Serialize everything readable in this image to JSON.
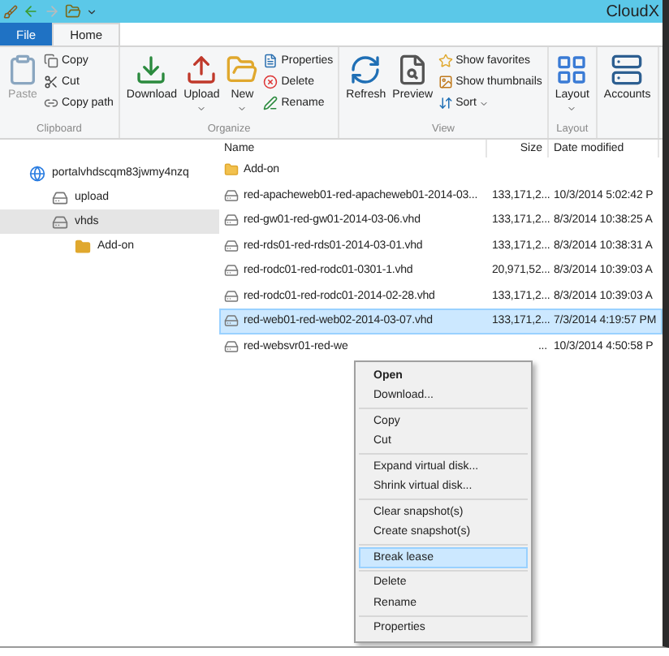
{
  "window": {
    "title": "CloudX"
  },
  "tabs": [
    {
      "label": "File",
      "kind": "file",
      "selected": false
    },
    {
      "label": "Home",
      "kind": "tab",
      "selected": true
    }
  ],
  "ribbon": {
    "groups": [
      {
        "label": "Clipboard",
        "large": [
          {
            "label": "Paste",
            "kind": "paste",
            "disabled": true,
            "dropdown": false
          }
        ],
        "small": [
          {
            "label": "Copy",
            "kind": "copy"
          },
          {
            "label": "Cut",
            "kind": "cut"
          },
          {
            "label": "Copy path",
            "kind": "copypath"
          }
        ]
      },
      {
        "label": "Organize",
        "large": [
          {
            "label": "Download",
            "kind": "download",
            "disabled": false,
            "dropdown": false
          },
          {
            "label": "Upload",
            "kind": "upload",
            "disabled": false,
            "dropdown": true
          },
          {
            "label": "New",
            "kind": "new",
            "disabled": false,
            "dropdown": true
          }
        ],
        "small": [
          {
            "label": "Properties",
            "kind": "properties"
          },
          {
            "label": "Delete",
            "kind": "delete"
          },
          {
            "label": "Rename",
            "kind": "rename"
          }
        ]
      },
      {
        "label": "View",
        "large": [
          {
            "label": "Refresh",
            "kind": "refresh",
            "disabled": false,
            "dropdown": false
          },
          {
            "label": "Preview",
            "kind": "preview",
            "disabled": false,
            "dropdown": false
          }
        ],
        "small": [
          {
            "label": "Show favorites",
            "kind": "favorites"
          },
          {
            "label": "Show thumbnails",
            "kind": "thumbnails"
          },
          {
            "label": "Sort",
            "kind": "sort",
            "dropdown": true
          }
        ]
      },
      {
        "label": "Layout",
        "large": [
          {
            "label": "Layout",
            "kind": "layout",
            "disabled": false,
            "dropdown": true
          }
        ]
      },
      {
        "large": [
          {
            "label": "Accounts",
            "kind": "accounts",
            "disabled": false,
            "dropdown": false
          }
        ]
      }
    ]
  },
  "tree": [
    {
      "label": "portalvhdscqm83jwmy4nzq",
      "kind": "account",
      "selected": false,
      "children": [
        {
          "label": "upload",
          "kind": "container",
          "selected": false
        },
        {
          "label": "vhds",
          "kind": "container",
          "selected": true,
          "children": [
            {
              "label": "Add-on",
              "kind": "folder",
              "selected": false
            }
          ]
        }
      ]
    }
  ],
  "file_list": {
    "columns": [
      "Name",
      "Size",
      "Date modified"
    ],
    "rows": [
      {
        "kind": "folder",
        "name": "Add-on",
        "selected": false
      },
      {
        "kind": "disk",
        "name": "red-apacheweb01-red-apacheweb01-2014-03...",
        "size": "133,171,2...",
        "date": "10/3/2014 5:02:42 P",
        "selected": false
      },
      {
        "kind": "disk",
        "name": "red-gw01-red-gw01-2014-03-06.vhd",
        "size": "133,171,2...",
        "date": "8/3/2014 10:38:25 A",
        "selected": false
      },
      {
        "kind": "disk",
        "name": "red-rds01-red-rds01-2014-03-01.vhd",
        "size": "133,171,2...",
        "date": "8/3/2014 10:38:31 A",
        "selected": false
      },
      {
        "kind": "disk",
        "name": "red-rodc01-red-rodc01-0301-1.vhd",
        "size": "20,971,52...",
        "date": "8/3/2014 10:39:03 A",
        "selected": false
      },
      {
        "kind": "disk",
        "name": "red-rodc01-red-rodc01-2014-02-28.vhd",
        "size": "133,171,2...",
        "date": "8/3/2014 10:39:03 A",
        "selected": false
      },
      {
        "kind": "disk",
        "name": "red-web01-red-web02-2014-03-07.vhd",
        "size": "133,171,2...",
        "date": "7/3/2014 4:19:57 PM",
        "selected": true
      },
      {
        "kind": "disk",
        "name": "red-websvr01-red-we",
        "size": "...",
        "date": "10/3/2014 4:50:58 P",
        "selected": false
      }
    ]
  },
  "context_menu": {
    "groups": [
      [
        {
          "label": "Open",
          "bold": true,
          "selected": false
        },
        {
          "label": "Download...",
          "bold": false,
          "selected": false
        }
      ],
      [
        {
          "label": "Copy",
          "bold": false,
          "selected": false
        },
        {
          "label": "Cut",
          "bold": false,
          "selected": false
        }
      ],
      [
        {
          "label": "Expand virtual disk...",
          "bold": false,
          "selected": false
        },
        {
          "label": "Shrink virtual disk...",
          "bold": false,
          "selected": false
        }
      ],
      [
        {
          "label": "Clear snapshot(s)",
          "bold": false,
          "selected": false
        },
        {
          "label": "Create snapshot(s)",
          "bold": false,
          "selected": false
        }
      ],
      [
        {
          "label": "Break lease",
          "bold": false,
          "selected": true
        }
      ],
      [
        {
          "label": "Delete",
          "bold": false,
          "selected": false
        },
        {
          "label": "Rename",
          "bold": false,
          "selected": false
        }
      ],
      [
        {
          "label": "Properties",
          "bold": false,
          "selected": false
        }
      ]
    ]
  }
}
